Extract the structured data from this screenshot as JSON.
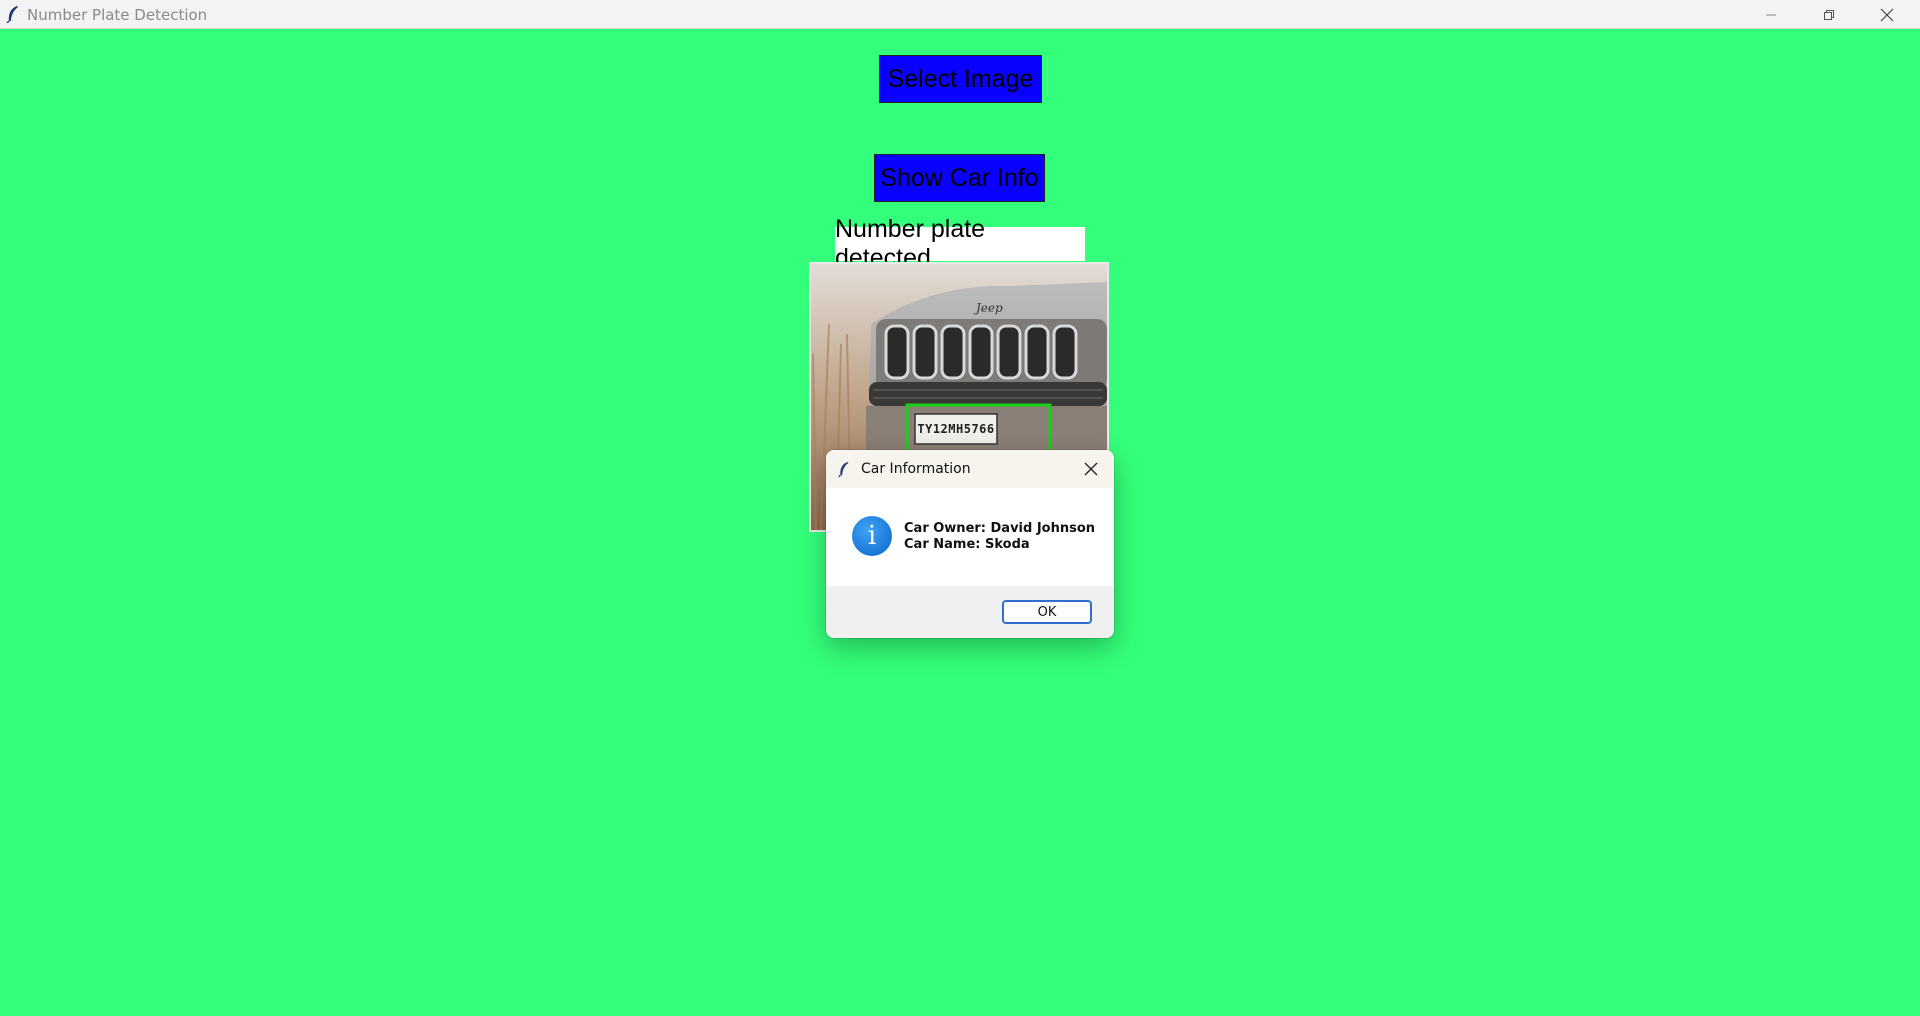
{
  "window": {
    "title": "Number Plate Detection",
    "app_icon": "feather-icon",
    "controls": [
      "minimize-icon",
      "restore-icon",
      "close-icon"
    ]
  },
  "main": {
    "select_button_label": "Select Image",
    "show_info_button_label": "Show Car Info",
    "status_heading": "Number plate detected",
    "plate_text": "TY12MH5766",
    "background_color": "#33ff7a",
    "button_color": "#0a00ff"
  },
  "dialog": {
    "title": "Car Information",
    "icon": "info-icon",
    "icon_glyph": "i",
    "message_line1": "Car Owner: David Johnson",
    "message_line2": "Car Name: Skoda",
    "ok_label": "OK"
  }
}
